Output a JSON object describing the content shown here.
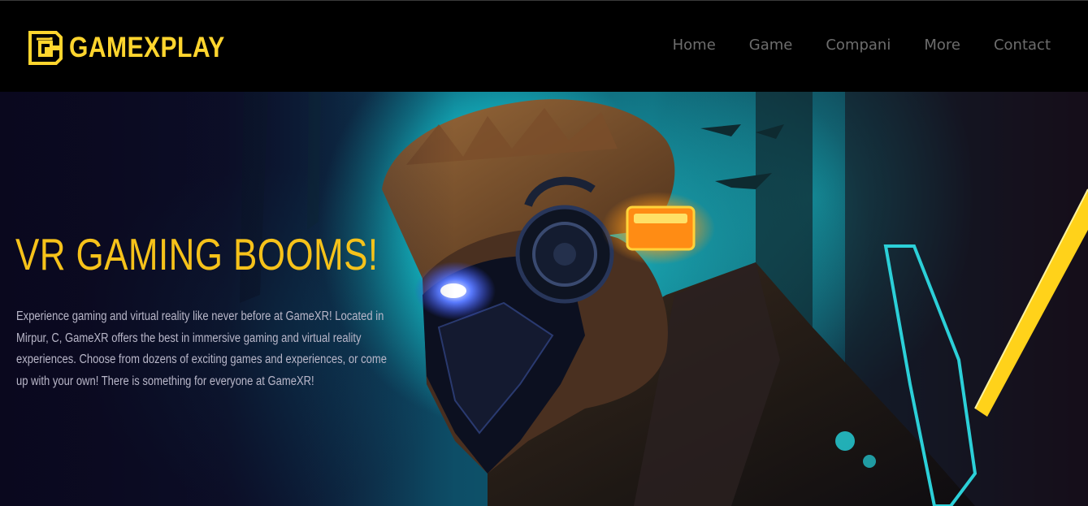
{
  "brand": {
    "name": "GAMEXPLAY",
    "logo_icon": "gamexplay-logo-icon",
    "accent": "#ffd52e"
  },
  "nav": {
    "items": [
      {
        "label": "Home"
      },
      {
        "label": "Game"
      },
      {
        "label": "Compani"
      },
      {
        "label": "More"
      },
      {
        "label": "Contact"
      }
    ],
    "color": "#6d6d6d"
  },
  "hero": {
    "title": "VR GAMING BOOMS!",
    "description": "Experience gaming and virtual reality like never before at GameXR! Located in Mirpur, C, GameXR offers the best in immersive gaming and virtual reality experiences. Choose from dozens of exciting games and experiences, or come up with your own! There is something for everyone at GameXR!",
    "title_color": "#f6c21a",
    "image": "cyberpunk-vr-gamer-illustration"
  }
}
